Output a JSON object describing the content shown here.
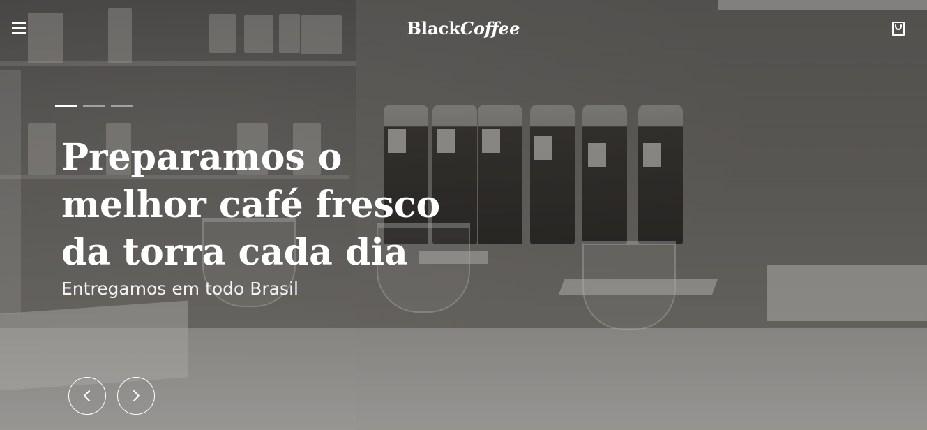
{
  "header": {
    "brand_part1": "Black",
    "brand_part2": "Coffee",
    "menu_icon": "hamburger-menu-icon",
    "cart_icon": "shopping-bag-icon"
  },
  "slider": {
    "indicators": [
      {
        "active": true
      },
      {
        "active": false
      },
      {
        "active": false
      }
    ],
    "headline_lines": [
      "Preparamos o",
      "melhor café fresco",
      "da torra cada dia"
    ],
    "subheadline": "Entregamos em todo Brasil",
    "prev_icon": "chevron-left-icon",
    "next_icon": "chevron-right-icon"
  },
  "colors": {
    "text": "#ffffff",
    "overlay": "rgba(0,0,0,0.28)"
  }
}
